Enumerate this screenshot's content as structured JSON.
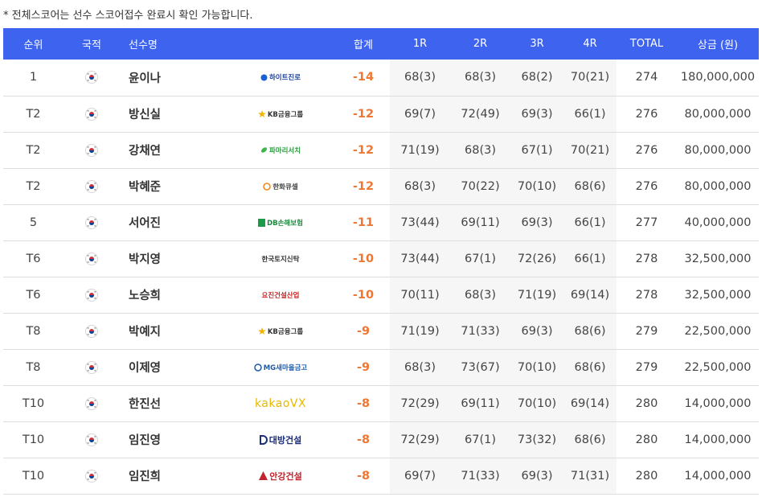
{
  "note": "* 전체스코어는 선수 스코어접수 완료시 확인 가능합니다.",
  "colors": {
    "header_bg": "#3e63ee",
    "score_orange": "#ee7733",
    "round_bg": "#f6f6f6"
  },
  "headers": {
    "rank": "순위",
    "nation": "국적",
    "name": "선수명",
    "sponsor": "",
    "total": "합계",
    "r1": "1R",
    "r2": "2R",
    "r3": "3R",
    "r4": "4R",
    "strokes": "TOTAL",
    "prize": "상금 (원)"
  },
  "rows": [
    {
      "rank": "1",
      "nation_icon": "korea-flag-icon",
      "name": "윤이나",
      "sponsor": "하이트진로",
      "total": "-14",
      "r1": "68(3)",
      "r2": "68(3)",
      "r3": "68(2)",
      "r4": "70(21)",
      "strokes": "274",
      "prize": "180,000,000"
    },
    {
      "rank": "T2",
      "nation_icon": "korea-flag-icon",
      "name": "방신실",
      "sponsor": "KB금융그룹",
      "total": "-12",
      "r1": "69(7)",
      "r2": "72(49)",
      "r3": "69(3)",
      "r4": "66(1)",
      "strokes": "276",
      "prize": "80,000,000"
    },
    {
      "rank": "T2",
      "nation_icon": "korea-flag-icon",
      "name": "강채연",
      "sponsor": "파마리서치",
      "total": "-12",
      "r1": "71(19)",
      "r2": "68(3)",
      "r3": "67(1)",
      "r4": "70(21)",
      "strokes": "276",
      "prize": "80,000,000"
    },
    {
      "rank": "T2",
      "nation_icon": "korea-flag-icon",
      "name": "박혜준",
      "sponsor": "한화큐셀",
      "total": "-12",
      "r1": "68(3)",
      "r2": "70(22)",
      "r3": "70(10)",
      "r4": "68(6)",
      "strokes": "276",
      "prize": "80,000,000"
    },
    {
      "rank": "5",
      "nation_icon": "korea-flag-icon",
      "name": "서어진",
      "sponsor": "DB손해보험",
      "total": "-11",
      "r1": "73(44)",
      "r2": "69(11)",
      "r3": "69(3)",
      "r4": "66(1)",
      "strokes": "277",
      "prize": "40,000,000"
    },
    {
      "rank": "T6",
      "nation_icon": "korea-flag-icon",
      "name": "박지영",
      "sponsor": "한국토지신탁",
      "total": "-10",
      "r1": "73(44)",
      "r2": "67(1)",
      "r3": "72(26)",
      "r4": "66(1)",
      "strokes": "278",
      "prize": "32,500,000"
    },
    {
      "rank": "T6",
      "nation_icon": "korea-flag-icon",
      "name": "노승희",
      "sponsor": "요진건설산업",
      "total": "-10",
      "r1": "70(11)",
      "r2": "68(3)",
      "r3": "71(19)",
      "r4": "69(14)",
      "strokes": "278",
      "prize": "32,500,000"
    },
    {
      "rank": "T8",
      "nation_icon": "korea-flag-icon",
      "name": "박예지",
      "sponsor": "KB금융그룹",
      "total": "-9",
      "r1": "71(19)",
      "r2": "71(33)",
      "r3": "69(3)",
      "r4": "68(6)",
      "strokes": "279",
      "prize": "22,500,000"
    },
    {
      "rank": "T8",
      "nation_icon": "korea-flag-icon",
      "name": "이제영",
      "sponsor": "MG새마을금고",
      "total": "-9",
      "r1": "68(3)",
      "r2": "73(67)",
      "r3": "70(10)",
      "r4": "68(6)",
      "strokes": "279",
      "prize": "22,500,000"
    },
    {
      "rank": "T10",
      "nation_icon": "korea-flag-icon",
      "name": "한진선",
      "sponsor": "kakaoVX",
      "total": "-8",
      "r1": "72(29)",
      "r2": "69(11)",
      "r3": "70(10)",
      "r4": "69(14)",
      "strokes": "280",
      "prize": "14,000,000"
    },
    {
      "rank": "T10",
      "nation_icon": "korea-flag-icon",
      "name": "임진영",
      "sponsor": "대방건설",
      "total": "-8",
      "r1": "72(29)",
      "r2": "67(1)",
      "r3": "73(32)",
      "r4": "68(6)",
      "strokes": "280",
      "prize": "14,000,000"
    },
    {
      "rank": "T10",
      "nation_icon": "korea-flag-icon",
      "name": "임진희",
      "sponsor": "안강건설",
      "total": "-8",
      "r1": "69(7)",
      "r2": "71(33)",
      "r3": "69(3)",
      "r4": "71(31)",
      "strokes": "280",
      "prize": "14,000,000"
    }
  ]
}
